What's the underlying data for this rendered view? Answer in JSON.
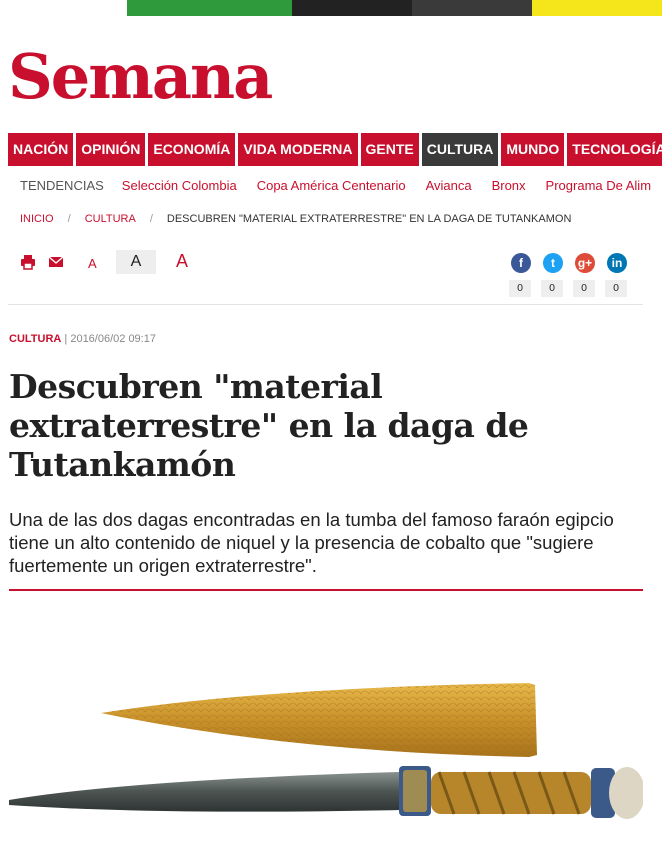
{
  "brand": {
    "name": "Semana",
    "color": "#c8102e"
  },
  "nav": {
    "items": [
      {
        "label": "NACIÓN",
        "active": false
      },
      {
        "label": "OPINIÓN",
        "active": false
      },
      {
        "label": "ECONOMÍA",
        "active": false
      },
      {
        "label": "VIDA MODERNA",
        "active": false
      },
      {
        "label": "GENTE",
        "active": false
      },
      {
        "label": "CULTURA",
        "active": true
      },
      {
        "label": "MUNDO",
        "active": false
      },
      {
        "label": "TECNOLOGÍA",
        "active": false
      }
    ]
  },
  "trends": {
    "label": "TENDENCIAS",
    "icon": "tag-icon",
    "links": [
      "Selección Colombia",
      "Copa América Centenario",
      "Avianca",
      "Bronx",
      "Programa De Alim"
    ]
  },
  "breadcrumb": {
    "home": "INICIO",
    "section": "CULTURA",
    "current": "DESCUBREN \"MATERIAL EXTRATERRESTRE\" EN LA DAGA DE TUTANKAMON"
  },
  "toolbar": {
    "print_icon": "print-icon",
    "email_icon": "email-icon",
    "font_small": "A",
    "font_medium": "A",
    "font_large": "A",
    "share": {
      "facebook": {
        "glyph": "f",
        "count": "0"
      },
      "twitter": {
        "glyph": "t",
        "count": "0"
      },
      "googleplus": {
        "glyph": "g+",
        "count": "0"
      },
      "linkedin": {
        "glyph": "in",
        "count": "0"
      }
    }
  },
  "article": {
    "section": "CULTURA",
    "separator": "|",
    "date": "2016/06/02 09:17",
    "title": "Descubren \"material extraterrestre\" en la daga de Tutankamón",
    "summary": "Una de las dos dagas encontradas en la tumba del famoso faraón egipcio tiene un alto contenido de niquel y la presencia de cobalto que \"sugiere fuertemente un origen extraterrestre\"."
  }
}
